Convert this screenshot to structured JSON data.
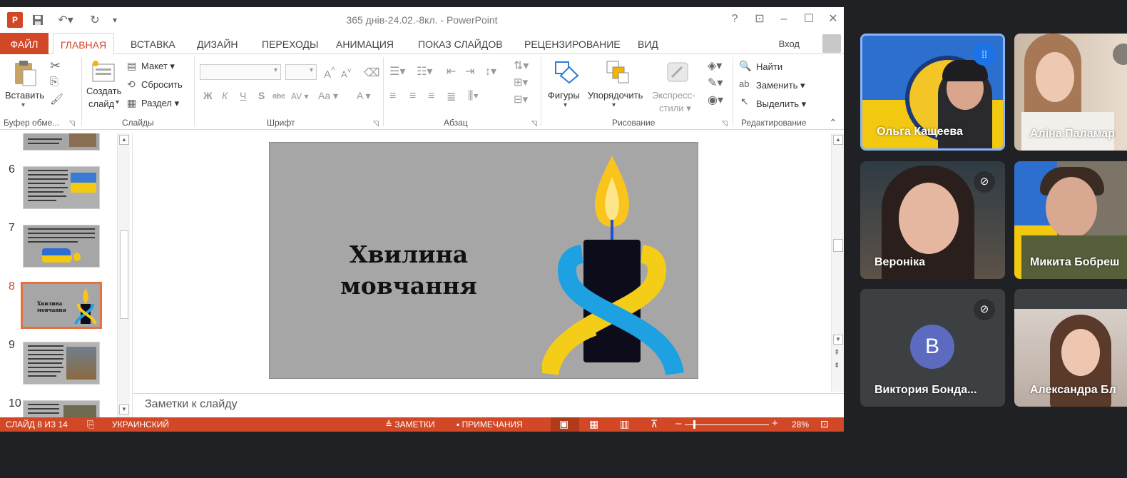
{
  "window": {
    "title": "365 днів-24.02.-8кл. - PowerPoint",
    "logo_text": "P",
    "signin": "Вход",
    "help_icon": "?",
    "restore_ribbon_icon": "⊡",
    "minimize_icon": "–",
    "maximize_icon": "☐",
    "close_icon": "✕"
  },
  "tabs": [
    "ФАЙЛ",
    "ГЛАВНАЯ",
    "ВСТАВКА",
    "ДИЗАЙН",
    "ПЕРЕХОДЫ",
    "АНИМАЦИЯ",
    "ПОКАЗ СЛАЙДОВ",
    "РЕЦЕНЗИРОВАНИЕ",
    "ВИД"
  ],
  "ribbon": {
    "clipboard": {
      "paste": "Вставить",
      "group": "Буфер обме..."
    },
    "slides": {
      "new_slide_1": "Создать",
      "new_slide_2": "слайд",
      "layout": "Макет",
      "reset": "Сбросить",
      "section": "Раздел",
      "group": "Слайды"
    },
    "font": {
      "group": "Шрифт",
      "bold": "Ж",
      "italic": "К",
      "underline": "Ч",
      "shadow": "S",
      "strike": "abc",
      "spacing": "AV",
      "case": "Aa",
      "color": "A",
      "grow": "A",
      "shrink": "A"
    },
    "paragraph": {
      "group": "Абзац"
    },
    "drawing": {
      "shapes": "Фигуры",
      "arrange": "Упорядочить",
      "styles_1": "Экспресс-",
      "styles_2": "стили",
      "group": "Рисование"
    },
    "editing": {
      "find": "Найти",
      "replace": "Заменить",
      "select": "Выделить",
      "group": "Редактирование"
    }
  },
  "thumbnails": [
    {
      "num": "6"
    },
    {
      "num": "7"
    },
    {
      "num": "8",
      "selected": true,
      "title": "Хвилина мовчання"
    },
    {
      "num": "9"
    },
    {
      "num": "10"
    }
  ],
  "slide": {
    "title_line1": "Хвилина",
    "title_line2": "мовчання",
    "colors": {
      "background": "#a6a6a6",
      "flame": "#f9c51c",
      "candle": "#0c0c1a",
      "blue": "#1da1e2",
      "yellow": "#f4cd19"
    }
  },
  "notes": {
    "placeholder": "Заметки к слайду"
  },
  "status": {
    "slide_info": "СЛАЙД 8 ИЗ 14",
    "language": "УКРАИНСКИЙ",
    "notes": "ЗАМЕТКИ",
    "comments": "ПРИМЕЧАНИЯ",
    "zoom": "28%",
    "zoom_minus": "–",
    "zoom_plus": "+"
  },
  "meet": {
    "participants": [
      {
        "name": "Ольга Кащеева",
        "speaking": true
      },
      {
        "name": "Аліна Паламар"
      },
      {
        "name": "Вероніка",
        "muted": true
      },
      {
        "name": "Микита Бобреш"
      },
      {
        "name": "Виктория Бонда...",
        "initial": "В",
        "muted": true
      },
      {
        "name": "Александра Бл"
      }
    ],
    "colors": {
      "tile_bg": "#3c4043",
      "speaking_border": "#8ab4f8",
      "avatar": "#5c6bc0"
    }
  }
}
